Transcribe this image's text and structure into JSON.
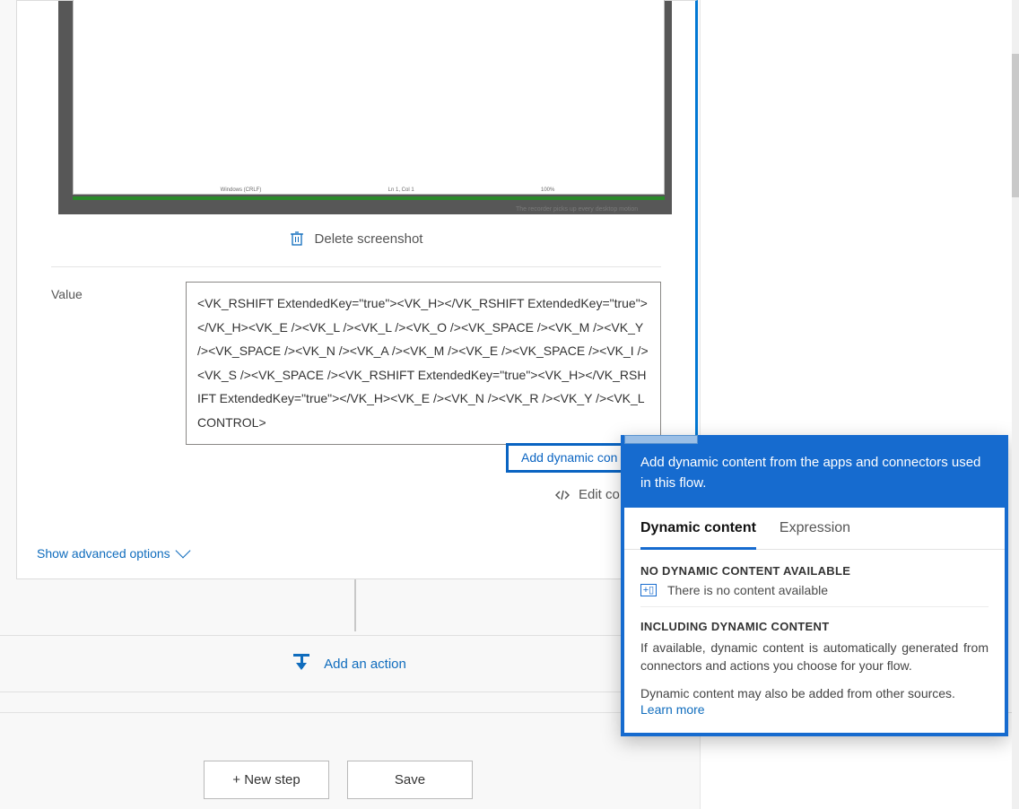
{
  "card": {
    "delete_label": "Delete screenshot",
    "value_label": "Value",
    "value_text": "<VK_RSHIFT ExtendedKey=\"true\"><VK_H></VK_RSHIFT ExtendedKey=\"true\"></VK_H><VK_E /><VK_L /><VK_L /><VK_O /><VK_SPACE /><VK_M /><VK_Y /><VK_SPACE /><VK_N /><VK_A /><VK_M /><VK_E /><VK_SPACE /><VK_I /><VK_S /><VK_SPACE /><VK_RSHIFT ExtendedKey=\"true\"><VK_H></VK_RSHIFT ExtendedKey=\"true\"></VK_H><VK_E /><VK_N /><VK_R /><VK_Y /><VK_LCONTROL>",
    "add_dynamic_label": "Add dynamic con",
    "edit_code_label": "Edit co",
    "show_advanced_label": "Show advanced options",
    "screenshot_status": {
      "a": "Windows (CRLF)",
      "b": "Ln 1, Col 1",
      "c": "100%"
    },
    "screenshot_caption": "The recorder picks up every desktop motion"
  },
  "add_action_label": "Add an action",
  "buttons": {
    "new_step": "+  New step",
    "save": "Save"
  },
  "popup": {
    "header": "Add dynamic content from the apps and connectors used in this flow.",
    "tabs": {
      "dynamic": "Dynamic content",
      "expression": "Expression"
    },
    "section1_title": "NO DYNAMIC CONTENT AVAILABLE",
    "section1_text": "There is no content available",
    "section2_title": "INCLUDING DYNAMIC CONTENT",
    "section2_text": "If available, dynamic content is automatically generated from connectors and actions you choose for your flow.",
    "other_sources": "Dynamic content may also be added from other sources.",
    "learn_more": "Learn more"
  }
}
